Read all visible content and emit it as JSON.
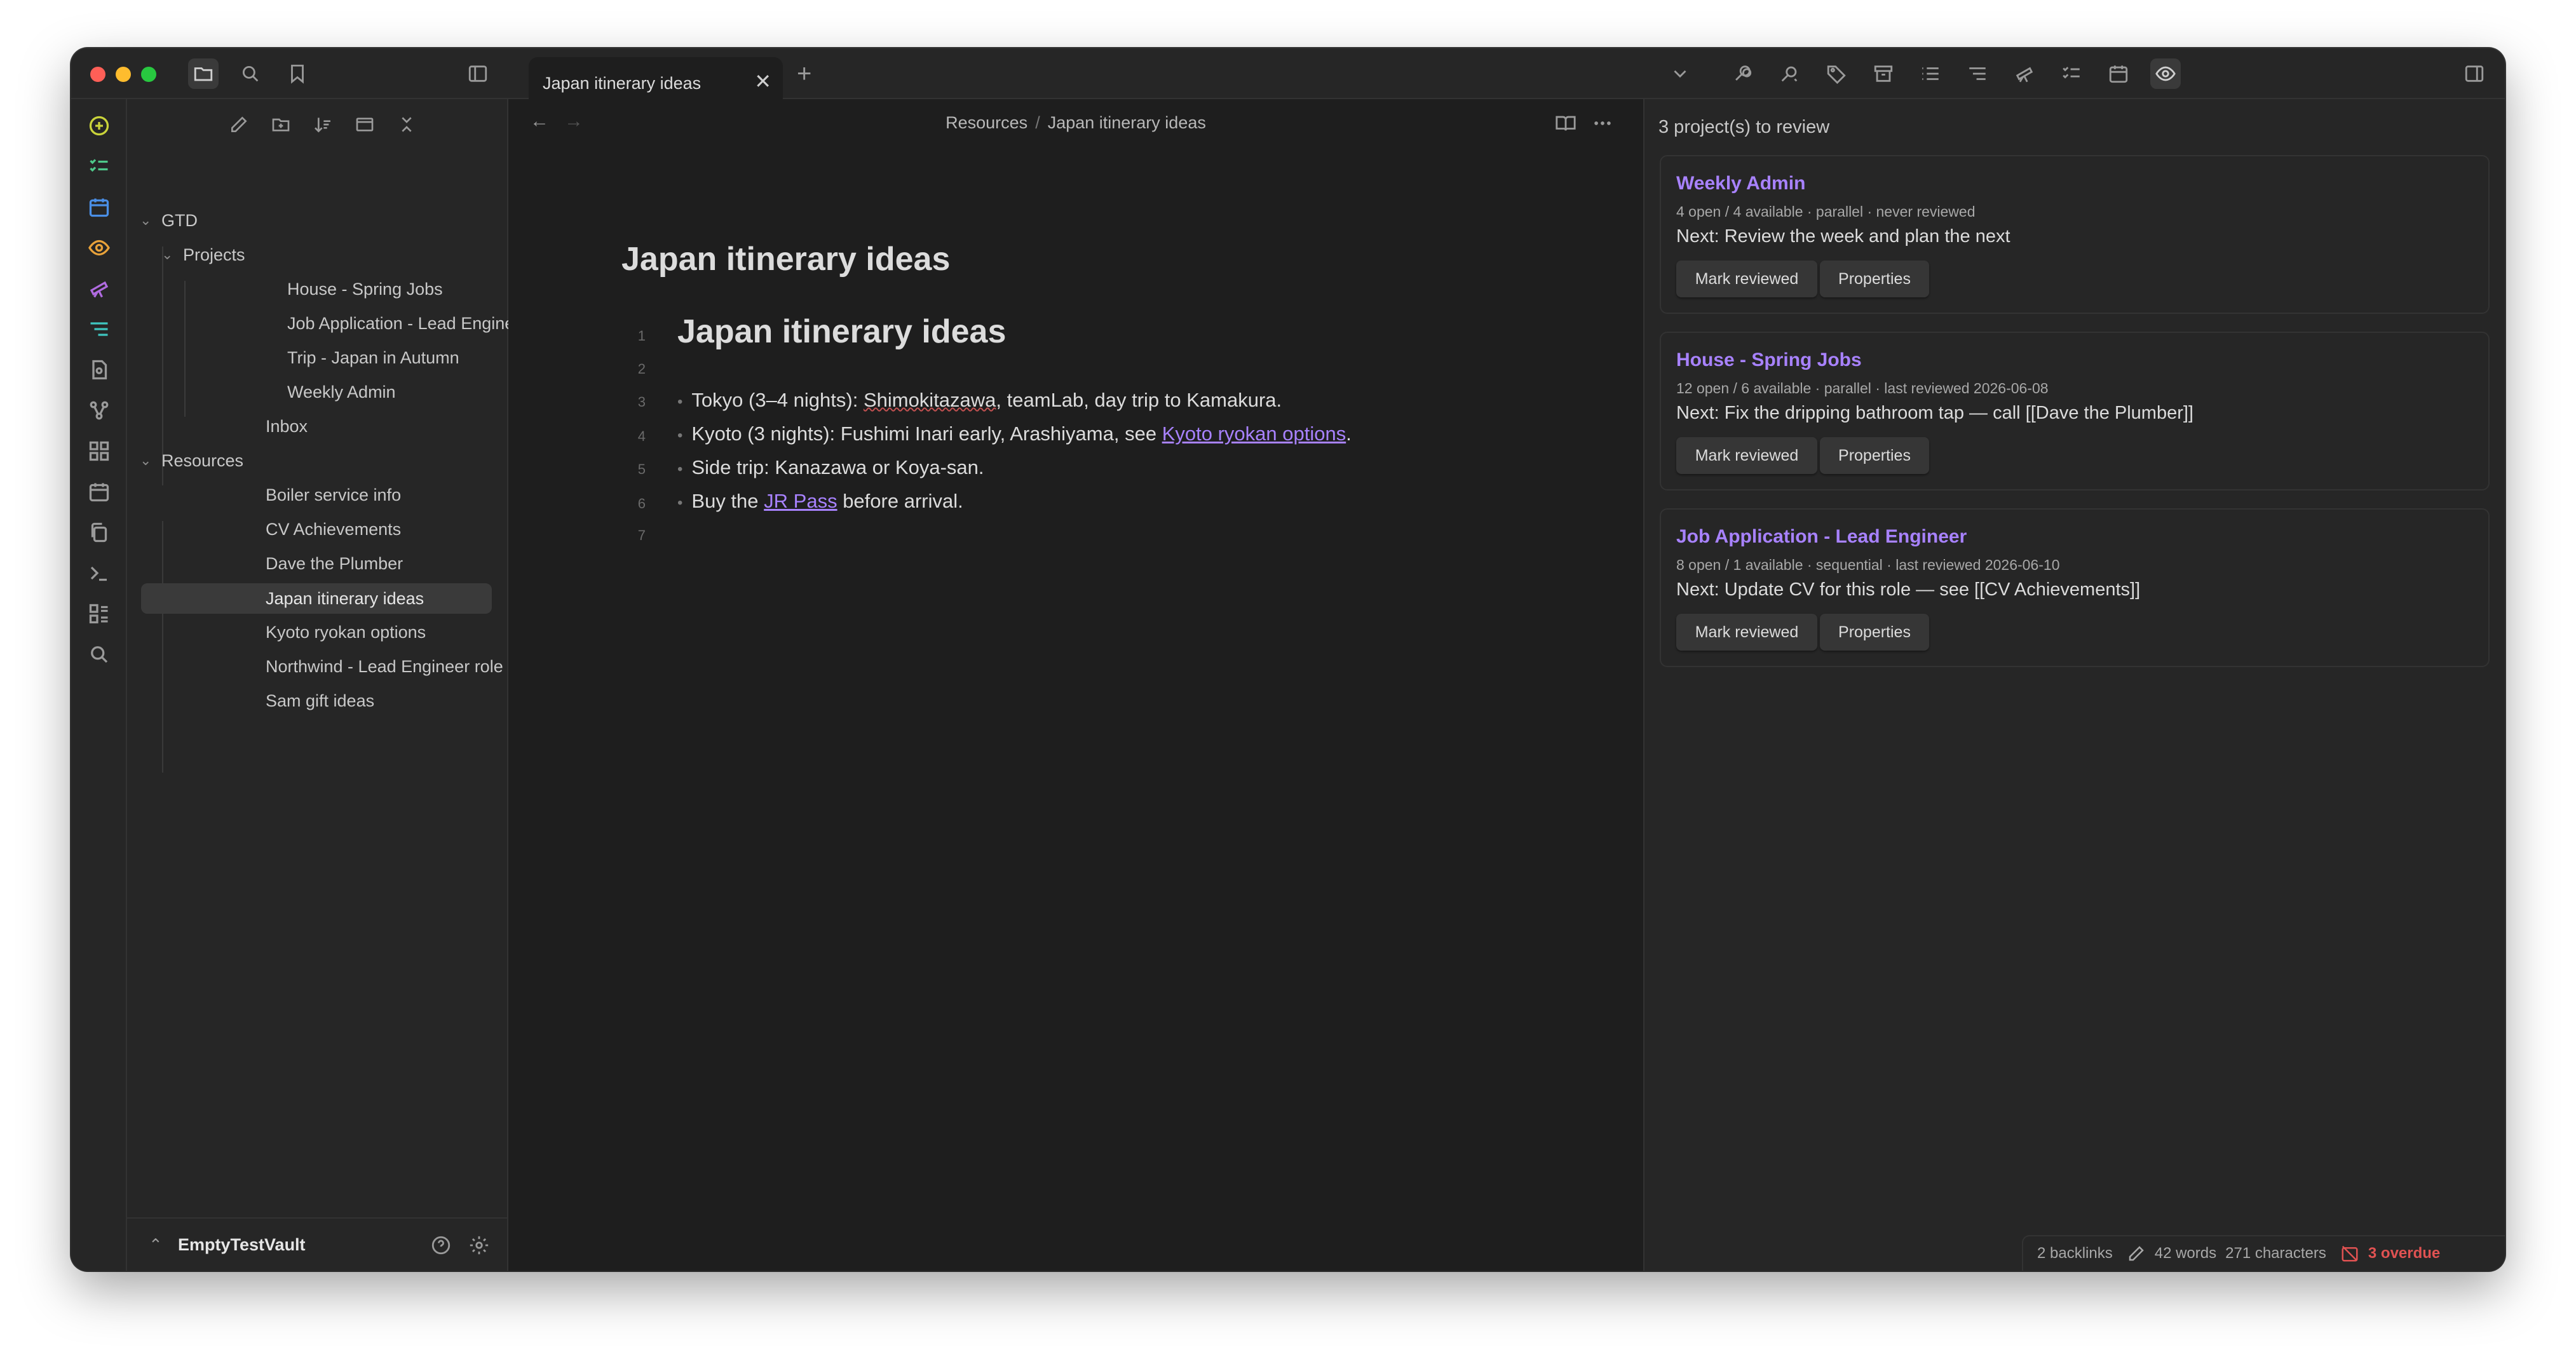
{
  "tab": {
    "title": "Japan itinerary ideas",
    "close": "✕",
    "add": "+"
  },
  "sidebar": {
    "tree": [
      {
        "label": "GTD",
        "chevron": "⌄"
      },
      {
        "label": "Projects",
        "chevron": "⌄"
      },
      {
        "label": "House - Spring Jobs"
      },
      {
        "label": "Job Application - Lead Engineer"
      },
      {
        "label": "Trip - Japan in Autumn"
      },
      {
        "label": "Weekly Admin"
      },
      {
        "label": "Inbox"
      },
      {
        "label": "Resources",
        "chevron": "⌄"
      },
      {
        "label": "Boiler service info"
      },
      {
        "label": "CV Achievements"
      },
      {
        "label": "Dave the Plumber"
      },
      {
        "label": "Japan itinerary ideas"
      },
      {
        "label": "Kyoto ryokan options"
      },
      {
        "label": "Northwind - Lead Engineer role"
      },
      {
        "label": "Sam gift ideas"
      }
    ],
    "vault": "EmptyTestVault",
    "vault_switch": "⌃"
  },
  "editor": {
    "breadcrumb_parent": "Resources",
    "breadcrumb_sep": "/",
    "breadcrumb_current": "Japan itinerary ideas",
    "inline_title": "Japan itinerary ideas",
    "line_numbers": [
      "1",
      "2",
      "3",
      "4",
      "5",
      "6",
      "7"
    ],
    "heading": "Japan itinerary ideas",
    "lines": {
      "l3_pre": "Tokyo (3–4 nights): ",
      "l3_sq": "Shimokitazawa",
      "l3_post": ", teamLab, day trip to Kamakura.",
      "l4_pre": "Kyoto (3 nights): Fushimi Inari early, Arashiyama, see ",
      "l4_link": "Kyoto ryokan options",
      "l4_post": ".",
      "l5": "Side trip: Kanazawa or Koya-san.",
      "l6_pre": "Buy the ",
      "l6_link": "JR Pass",
      "l6_post": " before arrival."
    },
    "bullet": "•"
  },
  "review": {
    "header": "3 project(s) to review",
    "cards": [
      {
        "title": "Weekly Admin",
        "meta": "4 open / 4 available · parallel · never reviewed",
        "next": "Next: Review the week and plan the next",
        "mark": "Mark reviewed",
        "props": "Properties"
      },
      {
        "title": "House - Spring Jobs",
        "meta": "12 open / 6 available · parallel · last reviewed 2026-06-08",
        "next": "Next: Fix the dripping bathroom tap — call [[Dave the Plumber]]",
        "mark": "Mark reviewed",
        "props": "Properties"
      },
      {
        "title": "Job Application - Lead Engineer",
        "meta": "8 open / 1 available · sequential · last reviewed 2026-06-10",
        "next": "Next: Update CV for this role — see [[CV Achievements]]",
        "mark": "Mark reviewed",
        "props": "Properties"
      }
    ]
  },
  "status": {
    "backlinks": "2 backlinks",
    "words": "42 words",
    "chars": "271 characters",
    "overdue": "3 overdue"
  },
  "colors": {
    "accent": "#a882ff",
    "overdue": "#e05252",
    "background": "#1e1e1e",
    "panel": "#262626"
  }
}
